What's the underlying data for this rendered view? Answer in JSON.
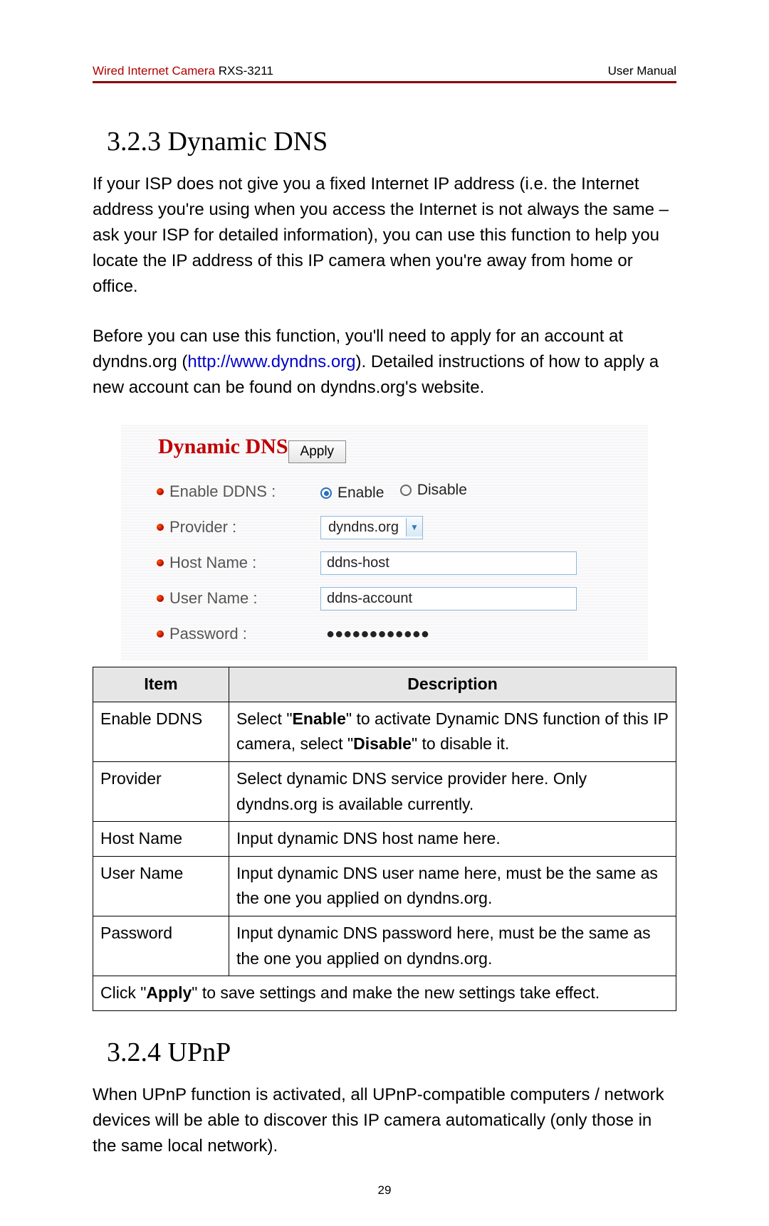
{
  "header": {
    "product": "Wired Internet Camera ",
    "model": "RXS-3211",
    "right": "User Manual"
  },
  "section1": {
    "heading": "3.2.3 Dynamic DNS",
    "para1": "If your ISP does not give you a fixed Internet IP address (i.e. the Internet address you're using when you access the Internet is not always the same – ask your ISP for detailed information), you can use this function to help you locate the IP address of this IP camera when you're away from home or office.",
    "para2_a": "Before you can use this function, you'll need to apply for an account at dyndns.org (",
    "para2_link": "http://www.dyndns.org",
    "para2_b": "). Detailed instructions of how to apply a new account can be found on dyndns.org's website."
  },
  "panel": {
    "title": "Dynamic DNS",
    "apply": "Apply",
    "rows": {
      "enable_label": "Enable DDNS :",
      "enable_opt1": "Enable",
      "enable_opt2": "Disable",
      "provider_label": "Provider :",
      "provider_value": "dyndns.org",
      "host_label": "Host Name :",
      "host_value": "ddns-host",
      "user_label": "User Name :",
      "user_value": "ddns-account",
      "pass_label": "Password :",
      "pass_value": "●●●●●●●●●●●●"
    }
  },
  "table": {
    "head_item": "Item",
    "head_desc": "Description",
    "r1_item": "Enable DDNS",
    "r1_a": "Select \"",
    "r1_b": "Enable",
    "r1_c": "\" to activate Dynamic DNS function of this IP camera, select \"",
    "r1_d": "Disable",
    "r1_e": "\" to disable it.",
    "r2_item": "Provider",
    "r2_desc": "Select dynamic DNS service provider here. Only dyndns.org is available currently.",
    "r3_item": "Host Name",
    "r3_desc": "Input dynamic DNS host name here.",
    "r4_item": "User Name",
    "r4_desc": "Input dynamic DNS user name here, must be the same as the one you applied on dyndns.org.",
    "r5_item": "Password",
    "r5_desc": "Input dynamic DNS password here, must be the same as the one you applied on dyndns.org.",
    "r6_a": "Click \"",
    "r6_b": "Apply",
    "r6_c": "\" to save settings and make the new settings take effect."
  },
  "section2": {
    "heading": "3.2.4 UPnP",
    "para": "When UPnP function is activated, all UPnP-compatible computers / network devices will be able to discover this IP camera automatically (only those in the same local network)."
  },
  "page_number": "29"
}
